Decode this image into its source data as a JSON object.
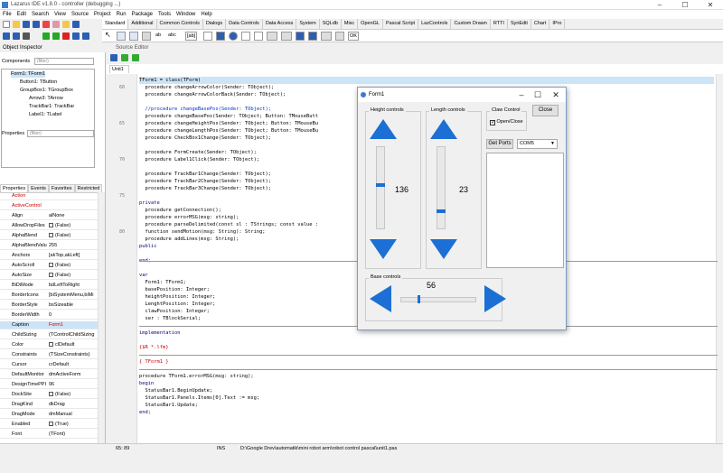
{
  "ide": {
    "title": "Lazarus IDE v1.8.0 - controller (debugging ...)",
    "menu": [
      "File",
      "Edit",
      "Search",
      "View",
      "Source",
      "Project",
      "Run",
      "Package",
      "Tools",
      "Window",
      "Help"
    ],
    "palette_tabs": [
      "Standard",
      "Additional",
      "Common Controls",
      "Dialogs",
      "Data Controls",
      "Data Access",
      "System",
      "SQLdb",
      "Misc",
      "OpenGL",
      "Pascal Script",
      "LazControls",
      "Custom Drawn",
      "RTTI",
      "SynEdit",
      "Chart",
      "IPro"
    ],
    "palette_items": [
      "ab",
      "abc",
      "[ab]",
      "OK"
    ]
  },
  "inspector": {
    "title": "Object Inspector",
    "components_label": "Components",
    "filter_placeholder": "(filter)",
    "tree": [
      "Form1: TForm1",
      "Button1: TButton",
      "GroupBox1: TGroupBox",
      "Arrow3: TArrow",
      "TrackBar1: TrackBar",
      "Label1: TLabel"
    ],
    "properties_label": "Properties",
    "tabs": [
      "Properties",
      "Events",
      "Favorites",
      "Restricted"
    ],
    "props": [
      {
        "k": "Action",
        "v": ""
      },
      {
        "k": "ActiveControl",
        "v": ""
      },
      {
        "k": "Align",
        "v": "alNone"
      },
      {
        "k": "AllowDropFiles",
        "v": "(False)"
      },
      {
        "k": "AlphaBlend",
        "v": "(False)"
      },
      {
        "k": "AlphaBlendValu",
        "v": "255"
      },
      {
        "k": "Anchors",
        "v": "[akTop,akLeft]"
      },
      {
        "k": "AutoScroll",
        "v": "(False)"
      },
      {
        "k": "AutoSize",
        "v": "(False)"
      },
      {
        "k": "BiDiMode",
        "v": "bdLeftToRight"
      },
      {
        "k": "BorderIcons",
        "v": "[biSystemMenu,biMi"
      },
      {
        "k": "BorderStyle",
        "v": "bsSizeable"
      },
      {
        "k": "BorderWidth",
        "v": "0"
      },
      {
        "k": "Caption",
        "v": "Form1"
      },
      {
        "k": "ChildSizing",
        "v": "(TControlChildSizing"
      },
      {
        "k": "Color",
        "v": "clDefault"
      },
      {
        "k": "Constraints",
        "v": "(TSizeConstraints)"
      },
      {
        "k": "Cursor",
        "v": "crDefault"
      },
      {
        "k": "DefaultMonitor",
        "v": "dmActiveForm"
      },
      {
        "k": "DesignTimePPI",
        "v": "96"
      },
      {
        "k": "DockSite",
        "v": "(False)"
      },
      {
        "k": "DragKind",
        "v": "dkDrag"
      },
      {
        "k": "DragMode",
        "v": "dmManual"
      },
      {
        "k": "Enabled",
        "v": "(True)"
      },
      {
        "k": "Font",
        "v": "(TFont)"
      }
    ]
  },
  "editor": {
    "title": "Source Editor",
    "tab": "Unit1",
    "line_numbers": [
      "60",
      "65",
      "70",
      "75",
      "80"
    ],
    "lines": [
      "TForm1 = class(TForm)",
      "  procedure changeArrowColor(Sender: TObject);",
      "  procedure changeArrowColorBack(Sender: TObject);",
      "",
      "  //procedure changeBasePos(Sender: TObject);",
      "  procedure changeBasePos(Sender: TObject; Button: TMouseButt",
      "  procedure changeHeightPos(Sender: TObject; Button: TMouseBu",
      "  procedure changeLengthPos(Sender: TObject; Button: TMouseBu",
      "  procedure CheckBox1Change(Sender: TObject);",
      "",
      "  procedure FormCreate(Sender: TObject);",
      "  procedure Label1Click(Sender: TObject);",
      "",
      "  procedure TrackBar1Change(Sender: TObject);",
      "  procedure TrackBar2Change(Sender: TObject);",
      "  procedure TrackBar3Change(Sender: TObject);",
      "",
      "private",
      "  procedure getConnection();",
      "  procedure errorMSG(msg: string);",
      "  procedure parseDelimited(const sl : TStrings; const value :",
      "  function sendMotion(msg: String): String;",
      "  procedure addLines(msg: String);",
      "public",
      "",
      "end;",
      "",
      "var",
      "  Form1: TForm1;",
      "  basePosition: Integer;",
      "  heightPosition: Integer;",
      "  LenghtPosition: Integer;",
      "  clawPosition: Integer;",
      "  ser : TBlockSerial;",
      "",
      "implementation",
      "",
      "{$R *.lfm}",
      "",
      "{ TForm1 }",
      "",
      "procedure TForm1.errorMSG(msg: string);",
      "begin",
      "  StatusBar1.BeginUpdate;",
      "  StatusBar1.Panels.Items[0].Text := msg;",
      "  StatusBar1.Update;",
      "end;"
    ]
  },
  "status": {
    "pos": "65: 89",
    "mode": "INS",
    "path": "D:\\Google Drev\\automatik\\mini robot arm\\robot control pascal\\unit1.pas"
  },
  "form1": {
    "title": "Form1",
    "height_label": "Height controls",
    "length_label": "Length controls",
    "claw_label": "Claw Control",
    "claw_checkbox": "Open/Close",
    "claw_checked": true,
    "close_button": "Close",
    "get_ports_button": "Get Ports",
    "port_value": "COM5",
    "base_label": "Base controls",
    "height_value": "136",
    "length_value": "23",
    "base_value": "56",
    "height_level": 0.53,
    "length_level": 0.2,
    "base_level": 0.22,
    "accent": "#1c6fd4"
  }
}
